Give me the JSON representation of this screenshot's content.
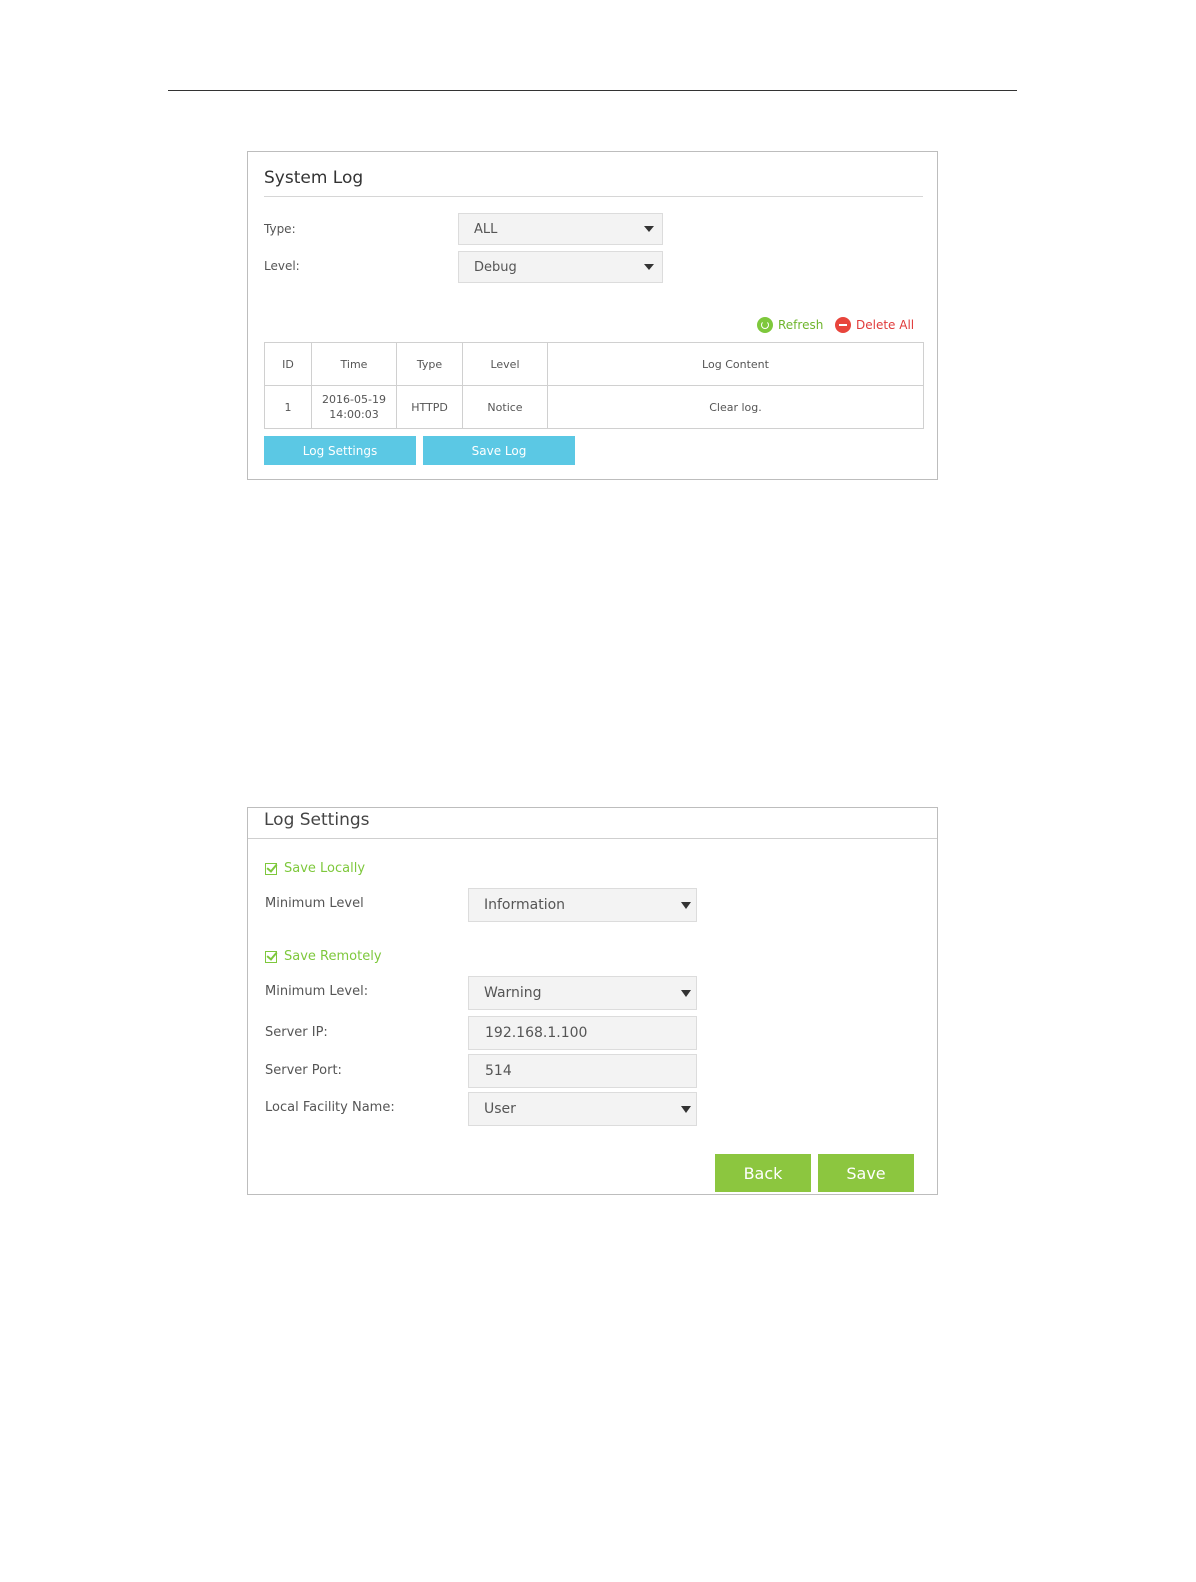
{
  "system_log": {
    "title": "System Log",
    "type_label": "Type:",
    "type_value": "ALL",
    "level_label": "Level:",
    "level_value": "Debug",
    "refresh_label": "Refresh",
    "delete_all_label": "Delete All",
    "table": {
      "headers": [
        "ID",
        "Time",
        "Type",
        "Level",
        "Log Content"
      ],
      "rows": [
        {
          "id": "1",
          "time_date": "2016-05-19",
          "time_clock": "14:00:03",
          "type": "HTTPD",
          "level": "Notice",
          "content": "Clear log."
        }
      ]
    },
    "log_settings_button": "Log Settings",
    "save_log_button": "Save Log"
  },
  "log_settings": {
    "title": "Log Settings",
    "save_locally_label": "Save Locally",
    "save_locally_checked": true,
    "local_min_level_label": "Minimum Level",
    "local_min_level_value": "Information",
    "save_remotely_label": "Save Remotely",
    "save_remotely_checked": true,
    "remote_min_level_label": "Minimum Level:",
    "remote_min_level_value": "Warning",
    "server_ip_label": "Server IP:",
    "server_ip_value": "192.168.1.100",
    "server_port_label": "Server Port:",
    "server_port_value": "514",
    "facility_label": "Local Facility Name:",
    "facility_value": "User",
    "back_button": "Back",
    "save_button": "Save"
  },
  "colors": {
    "accent_green": "#8cc63f",
    "button_blue": "#5bc8e4",
    "delete_red": "#e8453c"
  }
}
